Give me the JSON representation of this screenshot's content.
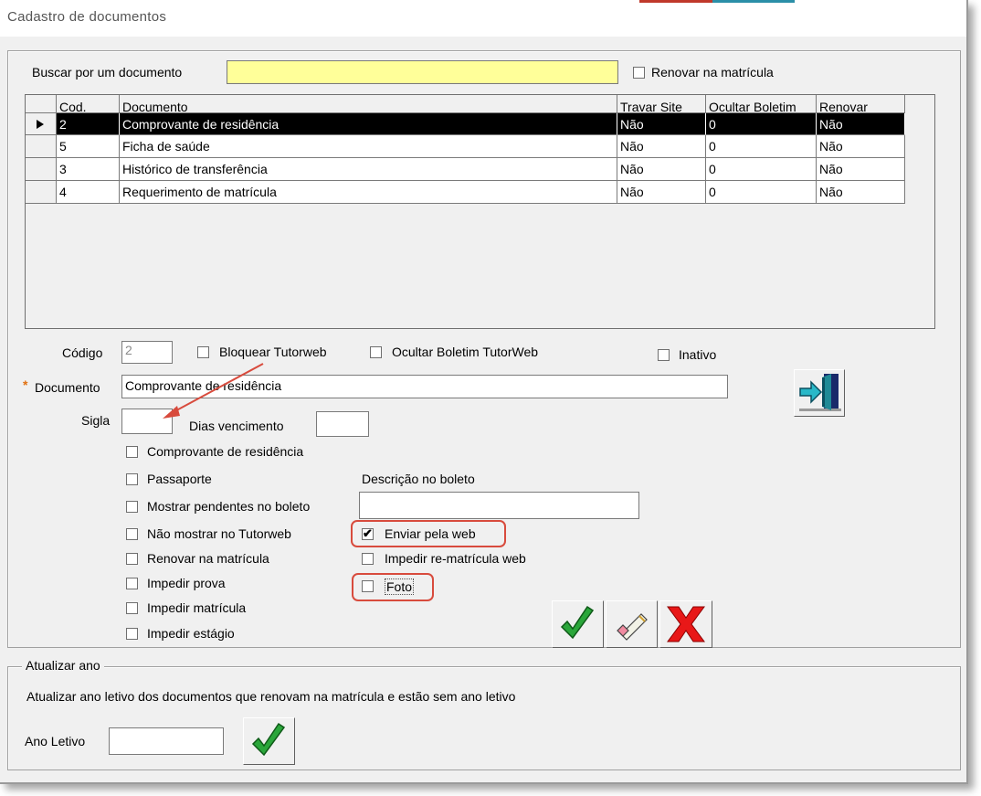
{
  "window": {
    "title": "Cadastro de documentos"
  },
  "search": {
    "label": "Buscar por um documento",
    "value": "",
    "renew_label": "Renovar na matrícula",
    "renew_checked": false
  },
  "grid": {
    "columns": [
      "Cod.",
      "Documento",
      "Travar Site",
      "Ocultar Boletim",
      "Renovar"
    ],
    "rows": [
      [
        "2",
        "Comprovante de residência",
        "Não",
        "0",
        "Não"
      ],
      [
        "5",
        "Ficha de saúde",
        "Não",
        "0",
        "Não"
      ],
      [
        "3",
        "Histórico de transferência",
        "Não",
        "0",
        "Não"
      ],
      [
        "4",
        "Requerimento de matrícula",
        "Não",
        "0",
        "Não"
      ]
    ],
    "selected_row": 0
  },
  "form": {
    "codigo_label": "Código",
    "codigo_value": "2",
    "bloquear_label": "Bloquear Tutorweb",
    "ocultar_label": "Ocultar Boletim TutorWeb",
    "inativo_label": "Inativo",
    "required_mark": "*",
    "documento_label": "Documento",
    "documento_value": "Comprovante de residência",
    "sigla_label": "Sigla",
    "sigla_value": "",
    "dias_label": "Dias vencimento",
    "dias_value": "",
    "descricao_label": "Descrição no boleto",
    "descricao_value": "",
    "checks_left": [
      {
        "label": "Comprovante de residência",
        "checked": false
      },
      {
        "label": "Passaporte",
        "checked": false
      },
      {
        "label": "Mostrar pendentes no boleto",
        "checked": false
      },
      {
        "label": "Não mostrar no Tutorweb",
        "checked": false
      },
      {
        "label": "Renovar na matrícula",
        "checked": false
      },
      {
        "label": "Impedir prova",
        "checked": false
      },
      {
        "label": "Impedir matrícula",
        "checked": false
      },
      {
        "label": "Impedir estágio",
        "checked": false
      }
    ],
    "checks_right": [
      {
        "label": "Enviar pela web",
        "checked": true
      },
      {
        "label": "Impedir re-matrícula web",
        "checked": false
      },
      {
        "label": "Foto",
        "checked": false
      }
    ],
    "check_glyph": "✔"
  },
  "update": {
    "group_label": "Atualizar ano",
    "description": "Atualizar ano letivo dos documentos que renovam na  matrícula e estão sem ano letivo",
    "ano_label": "Ano Letivo",
    "ano_value": ""
  },
  "icons": [
    "exit-door-icon",
    "confirm-check-icon",
    "eraser-icon",
    "cancel-x-icon"
  ],
  "colors": {
    "search_bg": "#ffff99",
    "annotation": "#d84b3d",
    "check_green": "#2aa63a",
    "cancel_red": "#e81818",
    "required": "#e07010"
  }
}
